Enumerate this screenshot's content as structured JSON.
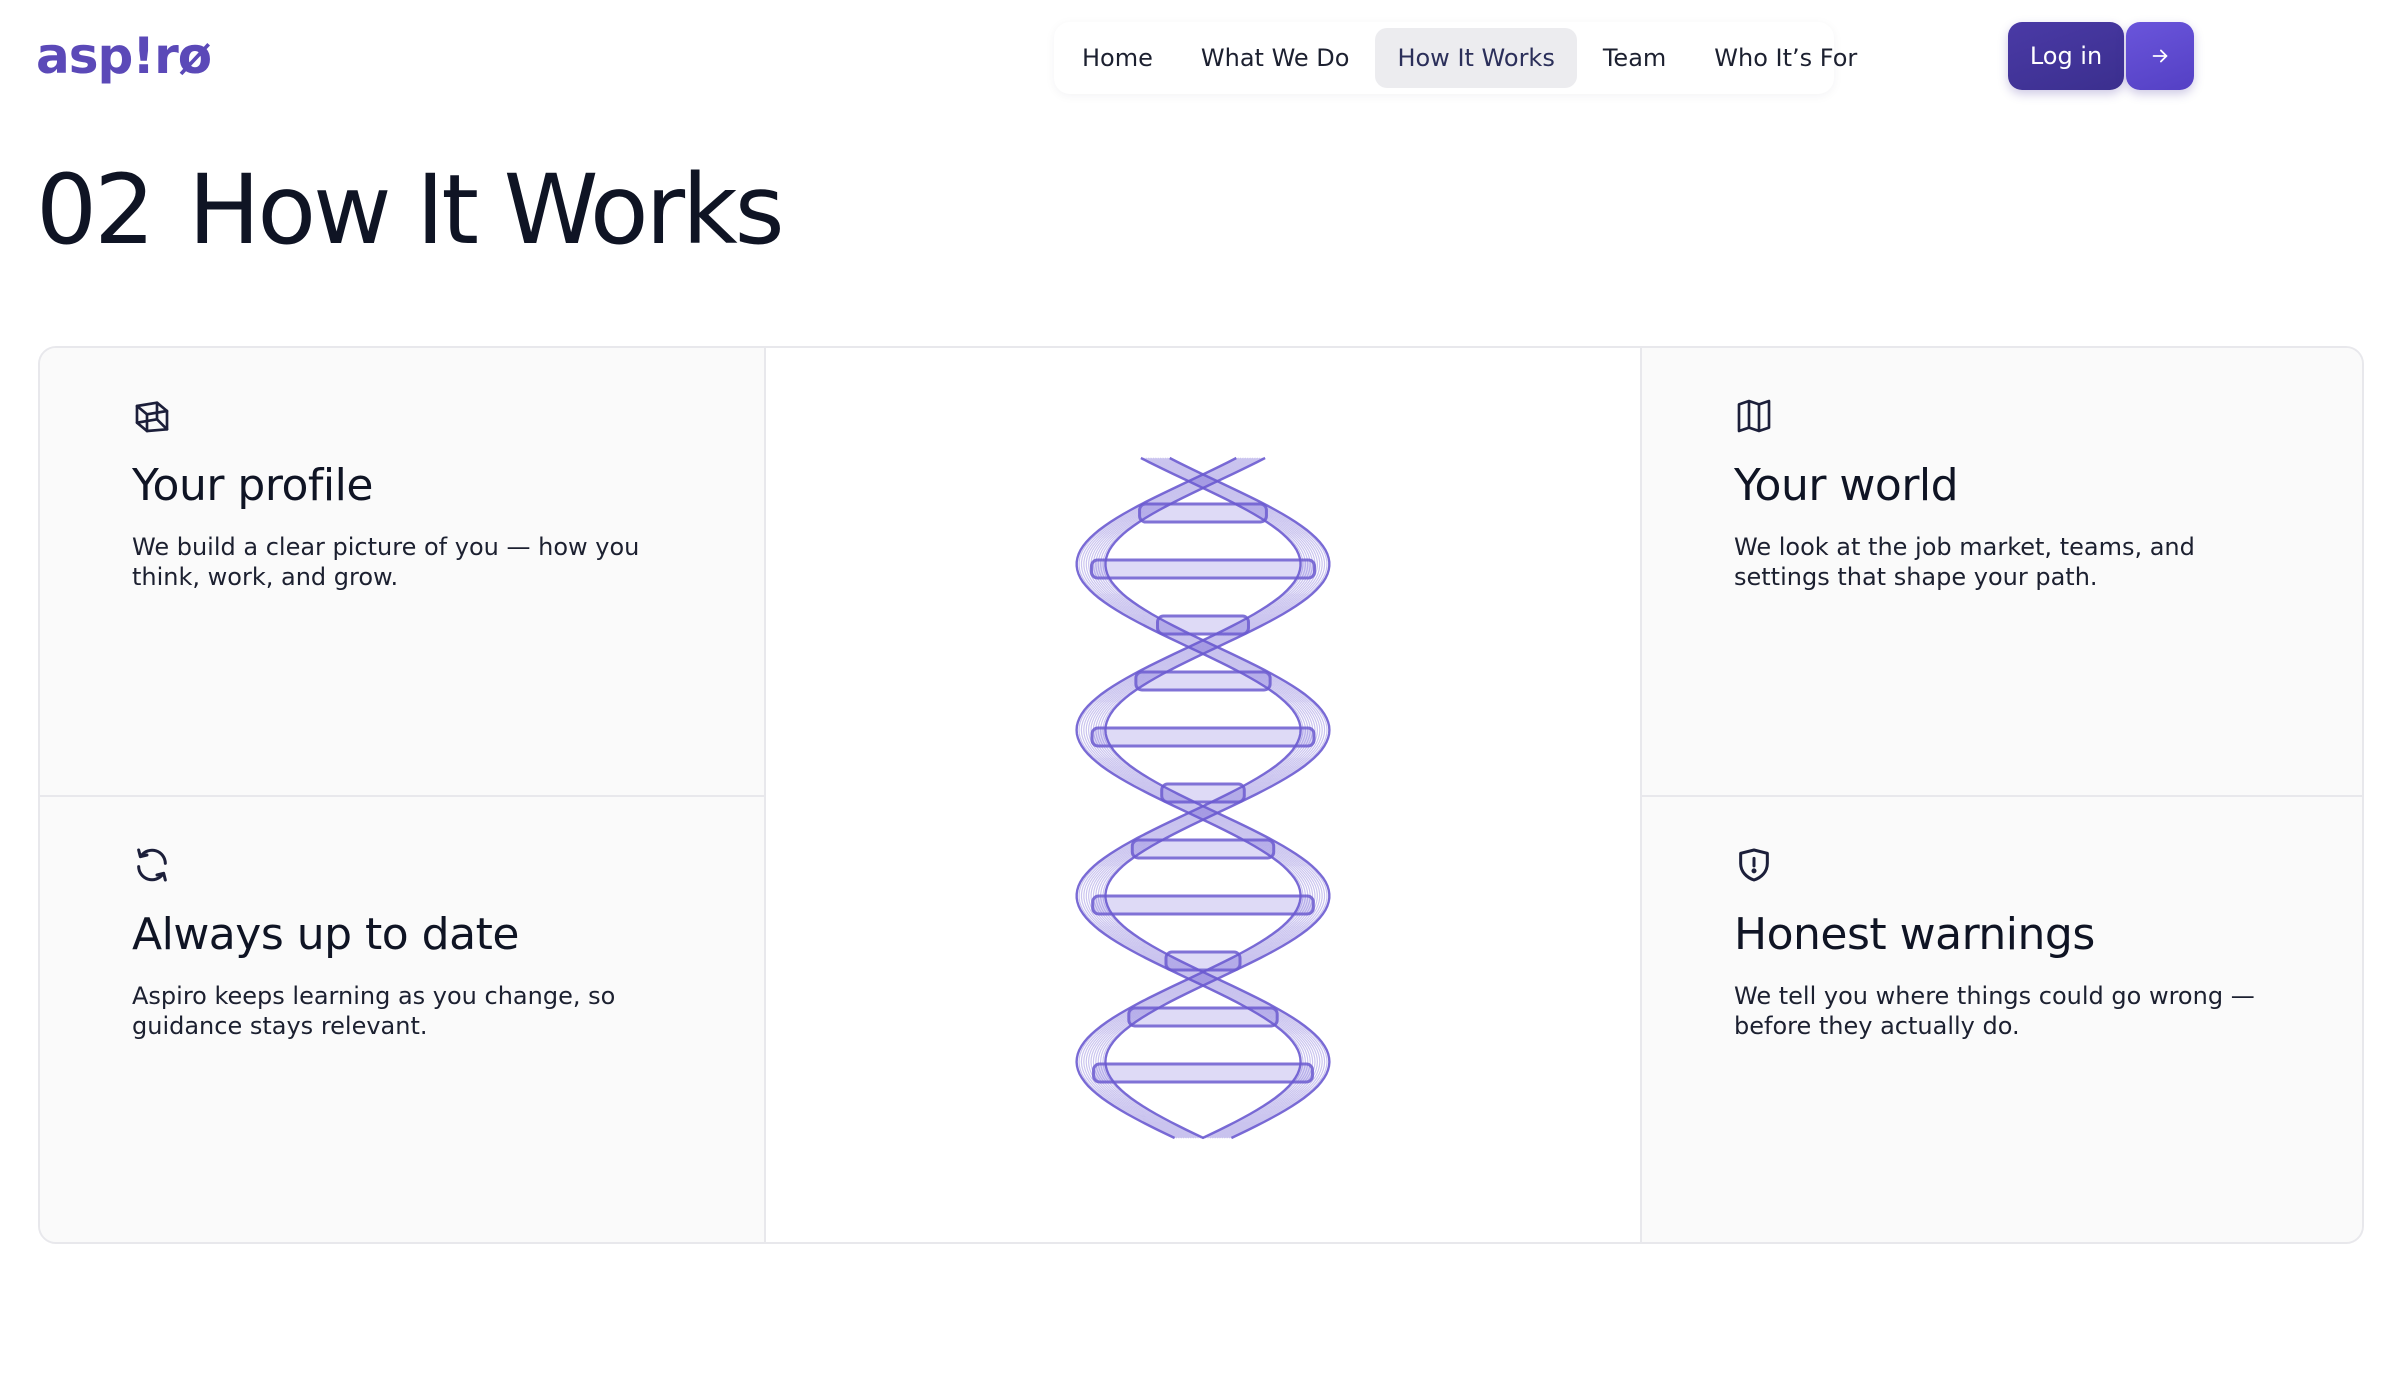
{
  "header": {
    "logo": "asp!rø",
    "nav": [
      "Home",
      "What We Do",
      "How It Works",
      "Team",
      "Who It’s For"
    ],
    "active_nav": "How It Works",
    "login_label": "Log in",
    "arrow_icon": "arrow-right-icon"
  },
  "section": {
    "number": "02",
    "title": "How It Works"
  },
  "cards": {
    "profile": {
      "icon": "cube-icon",
      "title": "Your profile",
      "desc": "We build a clear picture of you — how you think, work, and grow."
    },
    "world": {
      "icon": "map-icon",
      "title": "Your world",
      "desc": "We look at the job market, teams, and settings that shape your path."
    },
    "uptodate": {
      "icon": "refresh-icon",
      "title": "Always up to date",
      "desc": "Aspiro keeps learning as you change, so guidance stays relevant."
    },
    "warnings": {
      "icon": "shield-alert-icon",
      "title": "Honest warnings",
      "desc": "We tell you where things could go wrong — before they actually do."
    }
  },
  "colors": {
    "brand": "#5b49b8",
    "accent": "#6a55db",
    "dna": "#6a5ad0",
    "text": "#0f1424"
  }
}
